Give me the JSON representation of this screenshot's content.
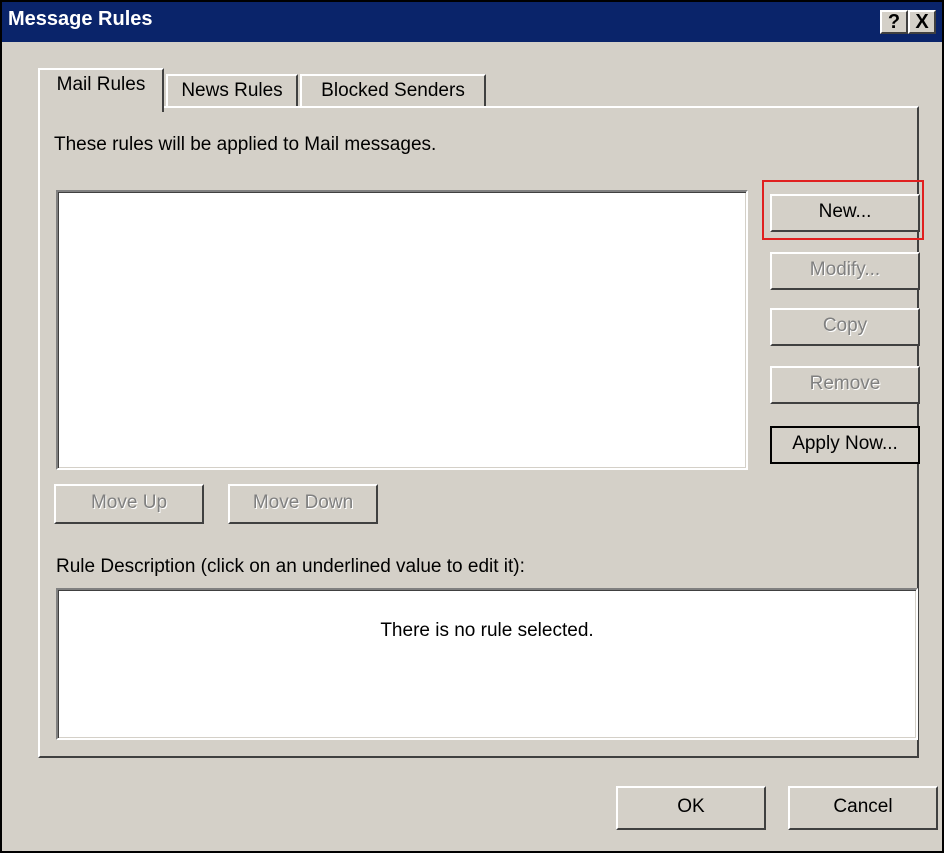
{
  "window": {
    "title": "Message Rules"
  },
  "titlebar": {
    "help_label": "?",
    "close_label": "X"
  },
  "tabs": [
    {
      "label": "Mail Rules",
      "active": true
    },
    {
      "label": "News Rules",
      "active": false
    },
    {
      "label": "Blocked Senders",
      "active": false
    }
  ],
  "panel": {
    "intro": "These rules will be applied to Mail messages.",
    "rules_list": [],
    "buttons": {
      "new": "New...",
      "modify": "Modify...",
      "copy": "Copy",
      "remove": "Remove",
      "apply_now": "Apply Now...",
      "move_up": "Move Up",
      "move_down": "Move Down"
    },
    "description_label": "Rule Description (click on an underlined value to edit it):",
    "description_text": "There is no rule selected."
  },
  "footer": {
    "ok": "OK",
    "cancel": "Cancel"
  },
  "colors": {
    "titlebar": "#0a246a",
    "dialog": "#d4d0c8",
    "highlight": "#e02020"
  }
}
